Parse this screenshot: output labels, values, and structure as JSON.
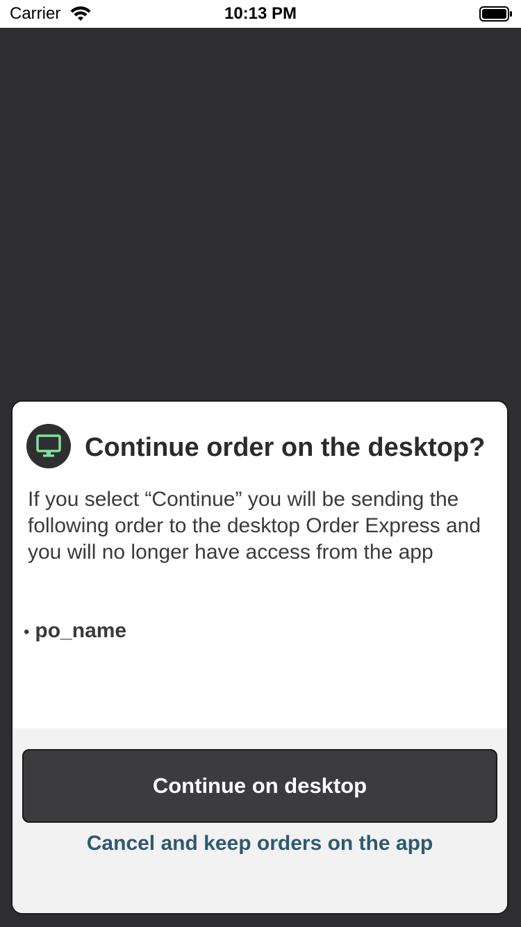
{
  "status_bar": {
    "carrier": "Carrier",
    "time": "10:13 PM"
  },
  "dialog": {
    "icon": "desktop-monitor-icon",
    "icon_color": "#7ee39a",
    "title": "Continue order on the desktop?",
    "message": "If you select “Continue” you will be sending the following order to the desktop Order Express and you will no longer have access from the app",
    "orders": [
      {
        "bullet": "•",
        "name": "po_name"
      }
    ],
    "primary_button": "Continue on desktop",
    "cancel_link": "Cancel and keep orders on the app",
    "link_color": "#2e5a6e"
  }
}
